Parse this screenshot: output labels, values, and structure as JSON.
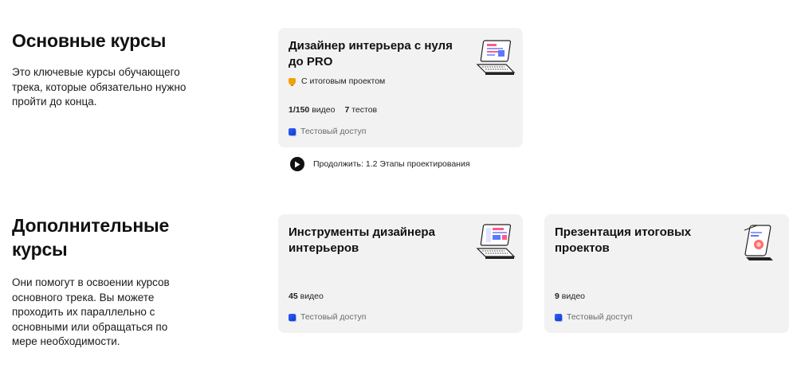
{
  "main_section": {
    "title": "Основные курсы",
    "description": "Это ключевые курсы обучающего трека, которые обязательно нужно пройти до конца."
  },
  "extra_section": {
    "title": "Дополнительные курсы",
    "description": "Они помогут в освоении курсов основного трека. Вы можете проходить их параллельно с основными или обращаться по мере необходимости."
  },
  "courses": [
    {
      "title": "Дизайнер интерьера с нуля до PRO",
      "badge": "С итоговым проектом",
      "videos_count": "1/150",
      "videos_label": "видео",
      "tests_count": "7",
      "tests_label": "тестов",
      "access": "Тестовый доступ",
      "illustration": "laptop-design-illustration",
      "continue": "Продолжить: 1.2 Этапы проектирования"
    },
    {
      "title": "Инструменты дизайнера интерьеров",
      "videos_count": "45",
      "videos_label": "видео",
      "access": "Тестовый доступ",
      "illustration": "laptop-tools-illustration"
    },
    {
      "title": "Презентация итоговых проектов",
      "videos_count": "9",
      "videos_label": "видео",
      "access": "Тестовый доступ",
      "illustration": "phone-presentation-illustration"
    }
  ],
  "colors": {
    "card_background": "#f2f2f2",
    "access_icon": "#2f63ff",
    "badge_icon": "#f2a100",
    "text": "#111111",
    "muted_text": "#6a6a6a"
  }
}
